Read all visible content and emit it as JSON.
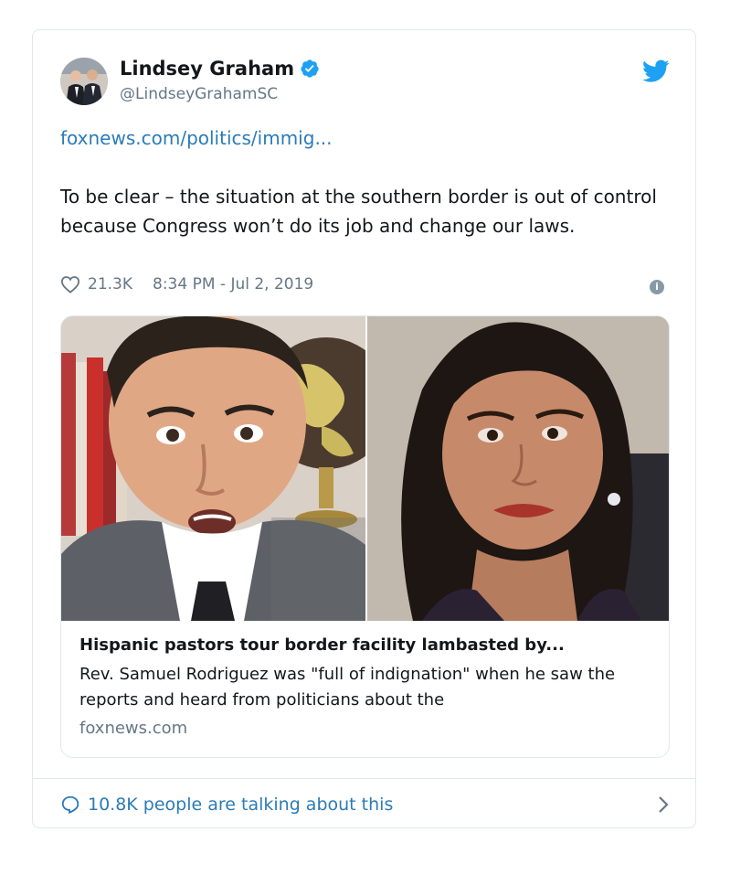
{
  "tweet": {
    "author_name": "Lindsey Graham",
    "author_handle": "@LindseyGrahamSC",
    "link_text": "foxnews.com/politics/immig...",
    "text": "To be clear – the situation at the southern border is out of control because Congress won’t do its job and change our laws.",
    "likes": "21.3K",
    "timestamp": "8:34 PM - Jul 2, 2019"
  },
  "card": {
    "title": "Hispanic pastors tour border facility lambasted by...",
    "description": "Rev. Samuel Rodriguez was \"full of indignation\" when he saw the reports and heard from politicians about the",
    "domain": "foxnews.com"
  },
  "footer": {
    "talking_text": "10.8K people are talking about this"
  },
  "colors": {
    "link": "#2b7bb9",
    "verified": "#1da1f2",
    "twitter_brand": "#1da1f2",
    "secondary_text": "#657786",
    "border": "#e1e8ed"
  },
  "icons": [
    "verified-badge-icon",
    "twitter-bird-icon",
    "heart-icon",
    "info-icon",
    "speech-bubble-icon",
    "chevron-right-icon"
  ]
}
